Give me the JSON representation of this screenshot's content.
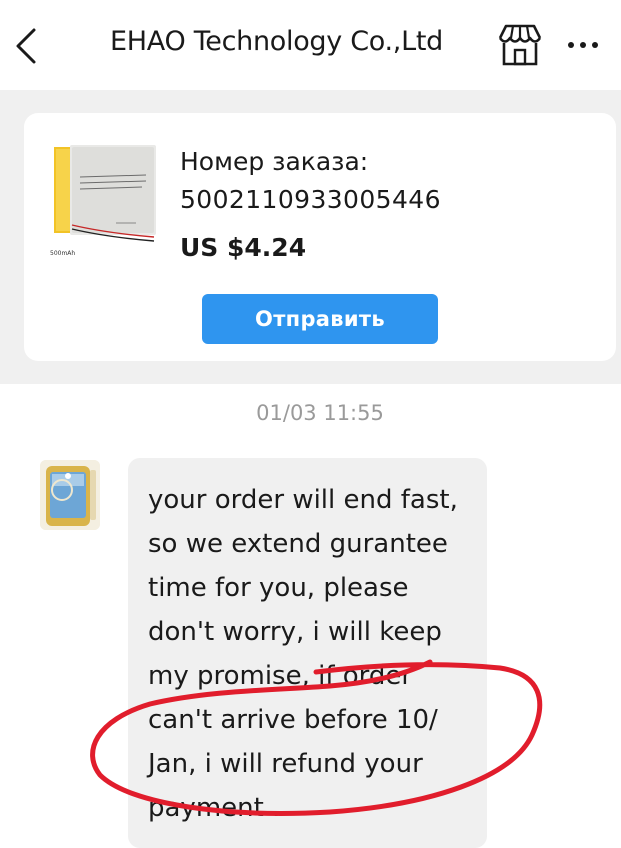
{
  "header": {
    "title": "EHAO Technology Co.,Ltd",
    "back_icon": "chevron-left-icon",
    "store_icon": "store-icon",
    "more_icon": "more-icon"
  },
  "order": {
    "label": "Номер заказа:",
    "number": "5002110933005446",
    "price": "US $4.24",
    "send_label": "Отправить",
    "product_image": {
      "battery_text": "500mAh"
    }
  },
  "chat": {
    "timestamp": "01/03 11:55",
    "messages": [
      {
        "sender": "seller",
        "text": "your order will end fast,\nso we extend gurantee\ntime for you, please\ndon't worry, i will keep\nmy promise, if order\ncan't arrive before 10/\nJan, i will refund your\npayment ."
      }
    ]
  },
  "colors": {
    "accent_blue": "#2f95ef",
    "annotation_red": "#e11d2c",
    "background_gray": "#f0f0f0"
  }
}
